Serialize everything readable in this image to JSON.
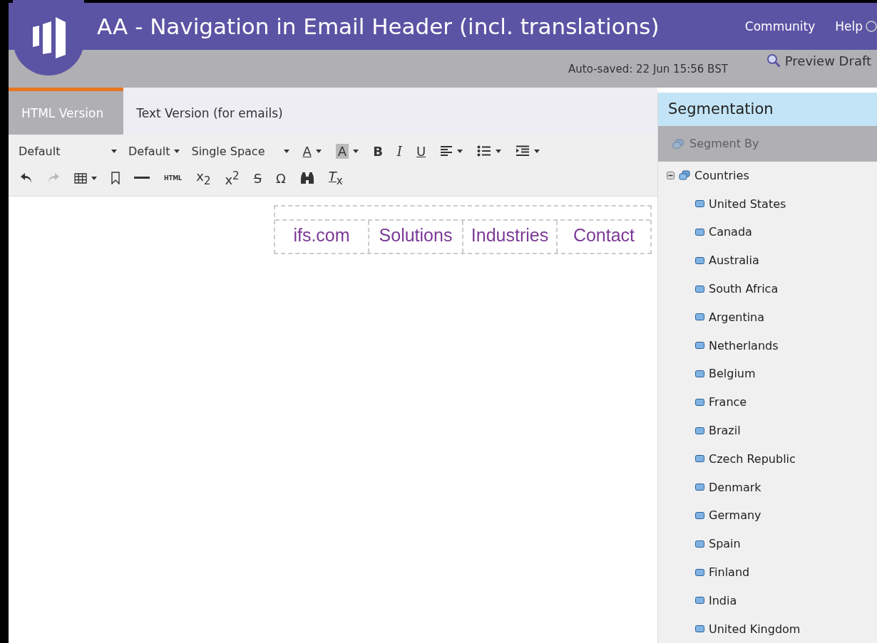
{
  "header": {
    "title": "AA - Navigation in Email Header (incl. translations)",
    "links": [
      "Community",
      "Help"
    ]
  },
  "subbar": {
    "autosave": "Auto-saved: 22 Jun 15:56 BST",
    "preview": "Preview Draft"
  },
  "tabs": [
    {
      "label": "HTML Version",
      "selected": true
    },
    {
      "label": "Text Version (for emails)",
      "selected": false
    }
  ],
  "toolbar": {
    "selects": [
      "Default",
      "Default",
      "Single Space"
    ],
    "glyphs": [
      "A",
      "A",
      "B",
      "I",
      "U",
      "HTML",
      "x$_{2}$",
      "x$^{2}$",
      "S",
      "Ω",
      "*T*$_{x}$"
    ],
    "redo": {
      "disabled": true
    }
  },
  "email_nav": [
    "ifs.com",
    "Solutions",
    "Industries",
    "Contact"
  ],
  "sidebar": {
    "title": "Segmentation",
    "segment_by": {
      "label": "Segment By",
      "disabled": true
    },
    "tree": [
      {
        "label": "Countries",
        "expanded": true,
        "children": [
          {
            "label": "United States"
          },
          {
            "label": "Canada"
          },
          {
            "label": "Australia"
          },
          {
            "label": "South Africa"
          },
          {
            "label": "Argentina"
          },
          {
            "label": "Netherlands"
          },
          {
            "label": "Belgium"
          },
          {
            "label": "France"
          },
          {
            "label": "Brazil"
          },
          {
            "label": "Czech Republic"
          },
          {
            "label": "Denmark"
          },
          {
            "label": "Germany"
          },
          {
            "label": "Spain"
          },
          {
            "label": "Finland"
          },
          {
            "label": "India"
          },
          {
            "label": "United Kingdom"
          }
        ]
      }
    ]
  }
}
